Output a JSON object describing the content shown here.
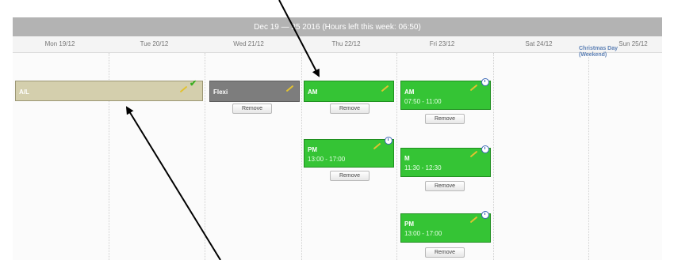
{
  "header": {
    "title": "Dec 19 — 25 2016 (Hours left this week: 06:50)"
  },
  "days": [
    "Mon 19/12",
    "Tue 20/12",
    "Wed 21/12",
    "Thu 22/12",
    "Fri 23/12",
    "Sat 24/12",
    "Sun 25/12"
  ],
  "holiday": {
    "name": "Christmas Day",
    "note": "(Weekend)"
  },
  "events": {
    "al": {
      "label": "A/L"
    },
    "flexi": {
      "label": "Flexi"
    },
    "thu_am": {
      "label": "AM"
    },
    "thu_pm": {
      "label": "PM",
      "time": "13:00 - 17:00"
    },
    "fri_am": {
      "label": "AM",
      "time": "07:50 - 11:00"
    },
    "fri_m": {
      "label": "M",
      "time": "11:30 - 12:30"
    },
    "fri_pm": {
      "label": "PM",
      "time": "13:00 - 17:00"
    }
  },
  "buttons": {
    "remove": "Remove"
  },
  "colors": {
    "header_bg": "#b3b3b3",
    "green_event": "#35c435",
    "al_event": "#d4cfad",
    "flexi_event": "#7d7d7d"
  },
  "icons": [
    "pencil-icon",
    "check-icon",
    "clock-icon"
  ]
}
